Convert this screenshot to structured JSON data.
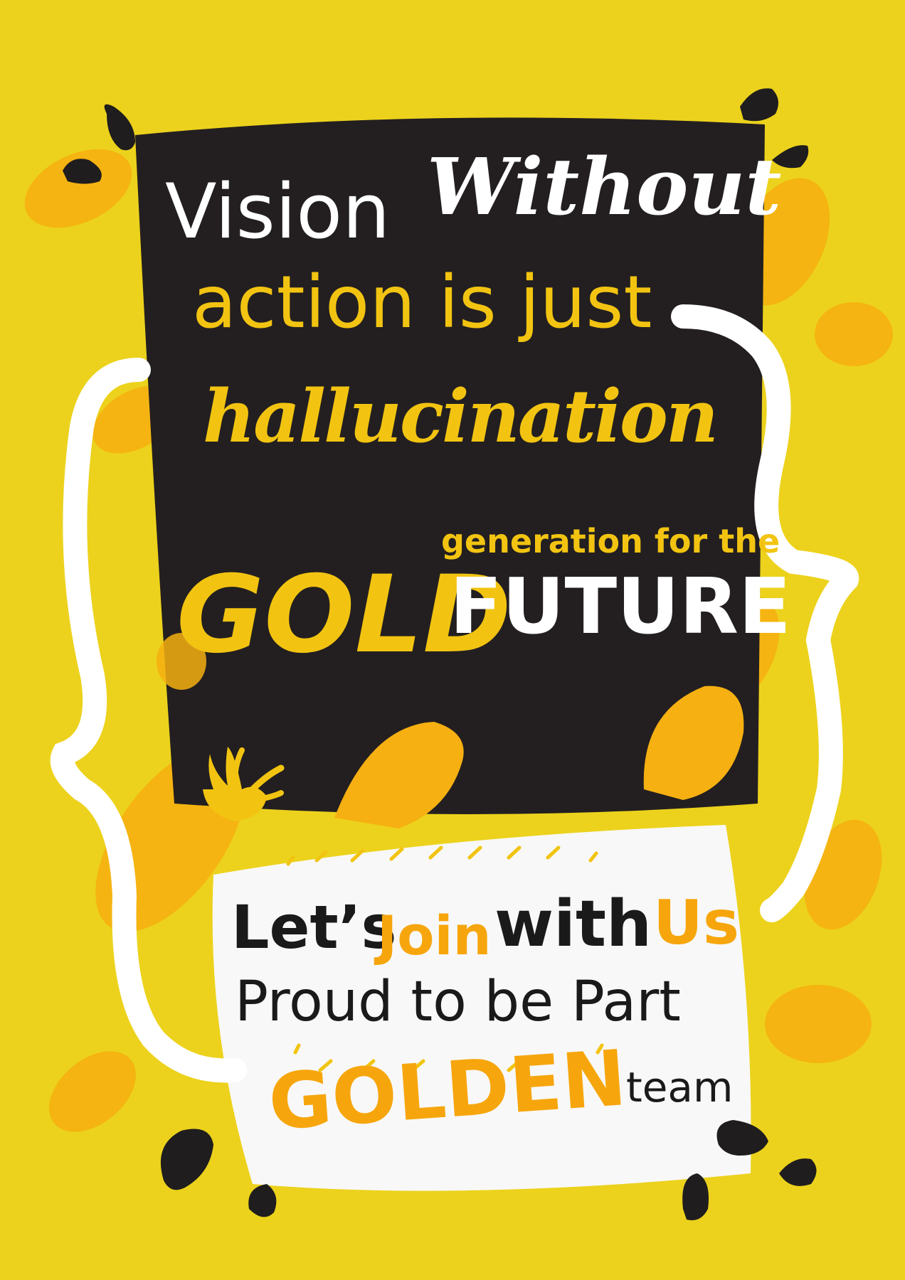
{
  "colors": {
    "background": "#ecd21c",
    "panel_dark": "#231f20",
    "panel_light": "#f8f8f8",
    "accent_orange": "#f6a60c",
    "accent_yellow": "#f2c411",
    "white": "#ffffff"
  },
  "top_panel": {
    "line1_word1": "Vision",
    "line1_word2": "Without",
    "line2": "action is just",
    "line3": "hallucination",
    "gold": "GOLD",
    "generation": "generation for the",
    "future": "FUTURE"
  },
  "bottom_panel": {
    "lets": "Let’s",
    "join": "Join",
    "with": "with",
    "us": "Us",
    "proud": "Proud to be Part",
    "golden": "GOLDEN",
    "team": "team"
  },
  "decorations": [
    "orange-blob-icon",
    "curly-brace-left-icon",
    "curly-brace-right-icon",
    "black-drop-icon",
    "hand-sparkle-icon"
  ]
}
